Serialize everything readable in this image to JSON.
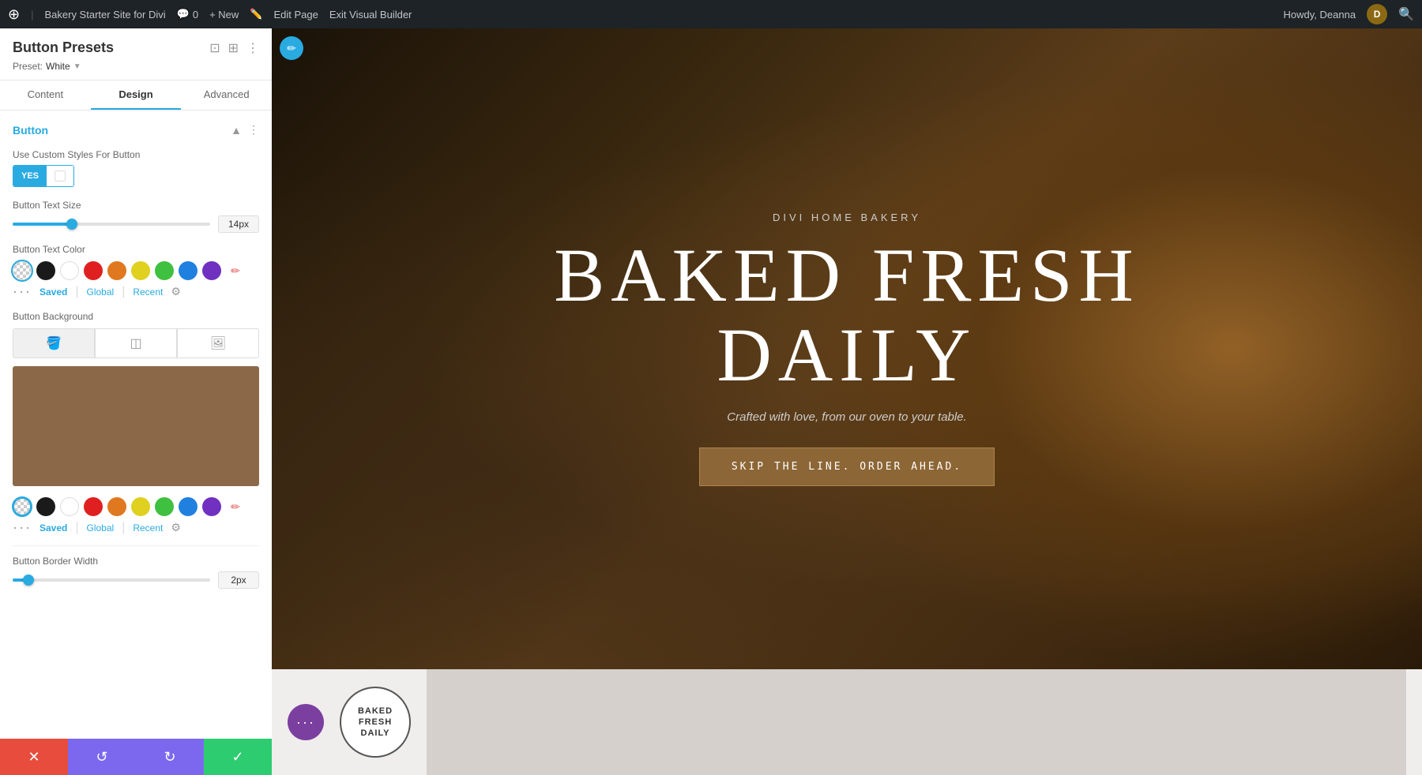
{
  "adminBar": {
    "wpIcon": "W",
    "siteName": "Bakery Starter Site for Divi",
    "commentCount": "0",
    "newLabel": "+ New",
    "editPageLabel": "Edit Page",
    "exitBuilderLabel": "Exit Visual Builder",
    "howdyLabel": "Howdy, Deanna",
    "avatarInitial": "D"
  },
  "panel": {
    "title": "Button Presets",
    "presetLabel": "Preset:",
    "presetValue": "White",
    "tabs": [
      "Content",
      "Design",
      "Advanced"
    ],
    "activeTab": "Design"
  },
  "section": {
    "title": "Button",
    "customStylesLabel": "Use Custom Styles For Button",
    "toggleYes": "YES",
    "toggleNo": "",
    "textSizeLabel": "Button Text Size",
    "textSizeValue": "14px",
    "textSizePercent": 30,
    "textColorLabel": "Button Text Color",
    "bgLabel": "Button Background",
    "bgColor": "#8B6948",
    "borderWidthLabel": "Button Border Width",
    "borderWidthValue": "2px"
  },
  "colorSwatches": {
    "text": [
      {
        "color": "transparent",
        "active": true
      },
      {
        "color": "#1a1a1a"
      },
      {
        "color": "#ffffff"
      },
      {
        "color": "#e02020"
      },
      {
        "color": "#e07820"
      },
      {
        "color": "#e0d020"
      },
      {
        "color": "#40c040"
      },
      {
        "color": "#2080e0"
      },
      {
        "color": "#7030c0"
      },
      {
        "color": "pen"
      }
    ],
    "bg": [
      {
        "color": "#8B6948",
        "active": true
      },
      {
        "color": "#1a1a1a"
      },
      {
        "color": "#ffffff"
      },
      {
        "color": "#e02020"
      },
      {
        "color": "#e07820"
      },
      {
        "color": "#e0d020"
      },
      {
        "color": "#40c040"
      },
      {
        "color": "#2080e0"
      },
      {
        "color": "#7030c0"
      },
      {
        "color": "pen"
      }
    ]
  },
  "colorMeta": {
    "savedLabel": "Saved",
    "globalLabel": "Global",
    "recentLabel": "Recent"
  },
  "hero": {
    "subtitle": "DIVI HOME BAKERY",
    "titleLine1": "BAKED FRESH",
    "titleLine2": "DAILY",
    "description": "Crafted with love, from our oven to your table.",
    "ctaLabel": "SKIP THE LINE. ORDER AHEAD."
  },
  "bottomStrip": {
    "dotBtnLabel": "···",
    "badgeLine1": "BAKED",
    "badgeLine2": "FRESH",
    "badgeLine3": "DAILY"
  },
  "footer": {
    "closeIcon": "✕",
    "undoIcon": "↺",
    "redoIcon": "↻",
    "saveIcon": "✓"
  }
}
